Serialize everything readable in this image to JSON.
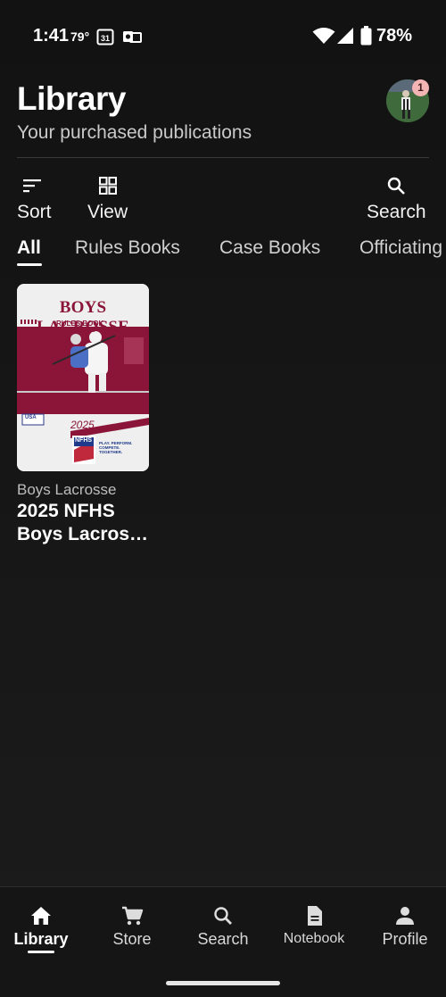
{
  "status": {
    "time": "1:41",
    "temp": "79°",
    "calendar_day": "31",
    "battery": "78%"
  },
  "header": {
    "title": "Library",
    "subtitle": "Your purchased publications",
    "avatar_badge": "1"
  },
  "toolbar": {
    "sort": "Sort",
    "view": "View",
    "search": "Search"
  },
  "tabs": [
    "All",
    "Rules Books",
    "Case Books",
    "Officiating"
  ],
  "book": {
    "cover_title": "BOYS LACROSSE",
    "cover_sub": "RULES BOOK",
    "cover_year": "2025",
    "cover_brand": "NFHS",
    "cover_usa": "USA",
    "cover_tagline": "PLAY. PERFORM. COMPETE. TOGETHER.",
    "category": "Boys Lacrosse",
    "title": "2025 NFHS Boys Lacros…"
  },
  "bottom_nav": {
    "library": "Library",
    "store": "Store",
    "search": "Search",
    "notebook": "Notebook",
    "profile": "Profile"
  },
  "colors": {
    "accent": "#8a1538",
    "background": "#141414"
  }
}
